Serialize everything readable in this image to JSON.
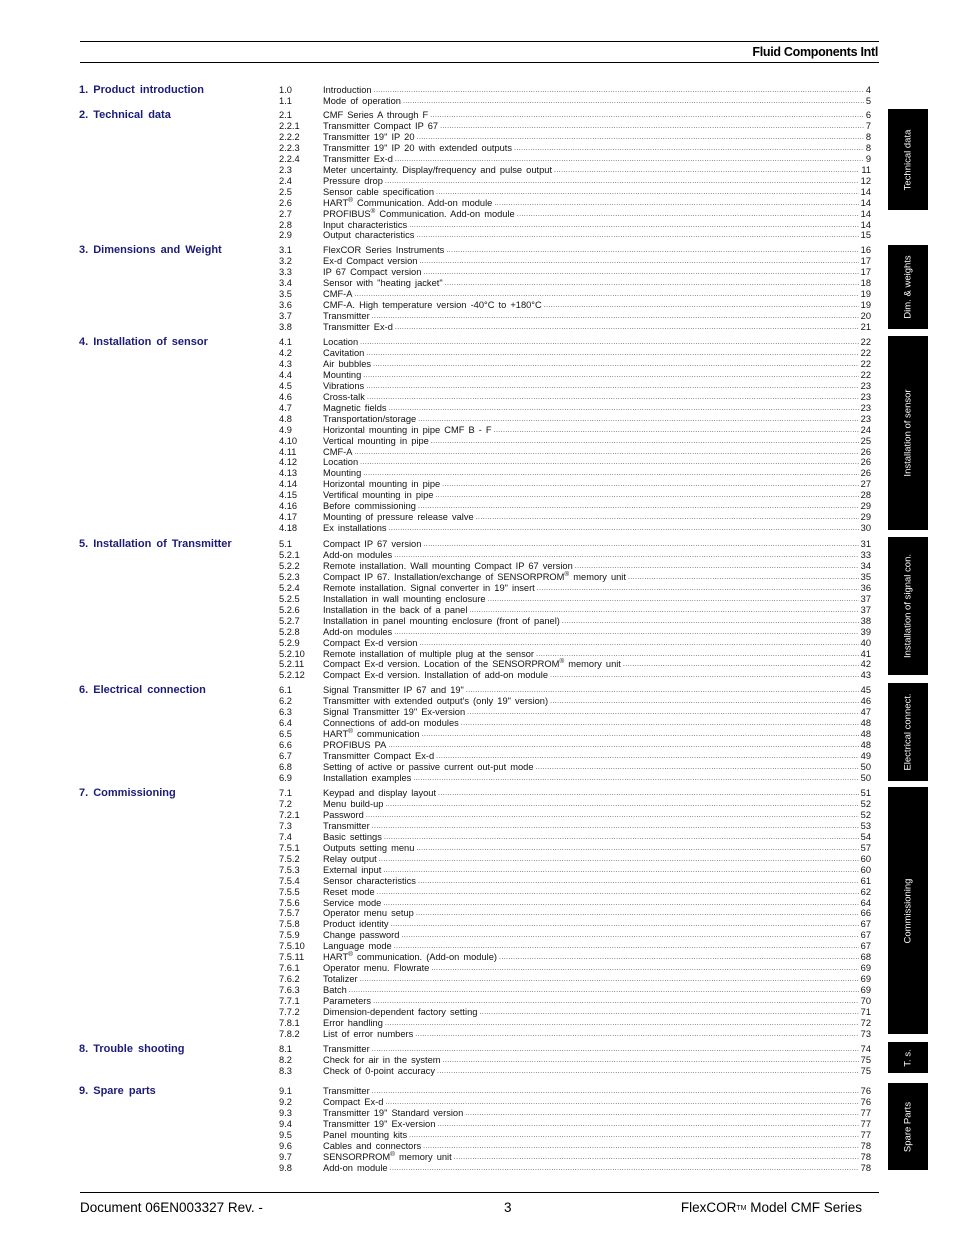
{
  "header": {
    "company": "Fluid Components Intl"
  },
  "sections": [
    {
      "title": "1.  Product introduction",
      "entries": [
        {
          "num": "1.0",
          "title": "Introduction",
          "page": "4"
        },
        {
          "num": "1.1",
          "title": "Mode of operation",
          "page": "5"
        }
      ]
    },
    {
      "title": "2.  Technical  data",
      "entries": [
        {
          "num": "2.1",
          "title": "CMF Series A through F",
          "page": "6"
        },
        {
          "num": "2.2.1",
          "title": "Transmitter Compact IP 67",
          "page": "7"
        },
        {
          "num": "2.2.2",
          "title": "Transmitter 19\" IP 20",
          "page": "8"
        },
        {
          "num": "2.2.3",
          "title": "Transmitter 19\" IP 20 with extended outputs",
          "page": "8"
        },
        {
          "num": "2.2.4",
          "title": "Transmitter Ex-d",
          "page": "9"
        },
        {
          "num": "2.3",
          "title": "Meter uncertainty. Display/frequency and pulse output",
          "page": "11"
        },
        {
          "num": "2.4",
          "title": "Pressure drop",
          "page": "12"
        },
        {
          "num": "2.5",
          "title": "Sensor cable specification",
          "page": "14"
        },
        {
          "num": "2.6",
          "title": "HART® Communication. Add-on module",
          "page": "14"
        },
        {
          "num": "2.7",
          "title": "PROFIBUS® Communication. Add-on module",
          "page": "14"
        },
        {
          "num": "2.8",
          "title": "Input characteristics",
          "page": "14"
        },
        {
          "num": "2.9",
          "title": "Output characteristics",
          "page": "15"
        }
      ]
    },
    {
      "title": "3.  Dimensions and  Weight",
      "entries": [
        {
          "num": "3.1",
          "title": "FlexCOR Series Instruments",
          "page": "16"
        },
        {
          "num": "3.2",
          "title": "Ex-d Compact version",
          "page": "17"
        },
        {
          "num": "3.3",
          "title": "IP 67 Compact version",
          "page": "17"
        },
        {
          "num": "3.4",
          "title": "Sensor with \"heating jacket\"",
          "page": "18"
        },
        {
          "num": "3.5",
          "title": "CMF-A",
          "page": "19"
        },
        {
          "num": "3.6",
          "title": "CMF-A. High temperature version -40°C to +180°C",
          "page": "19"
        },
        {
          "num": "3.7",
          "title": "Transmitter",
          "page": "20"
        },
        {
          "num": "3.8",
          "title": "Transmitter Ex-d",
          "page": "21"
        }
      ]
    },
    {
      "title": "4.  Installation of sensor",
      "entries": [
        {
          "num": "4.1",
          "title": "Location",
          "page": "22"
        },
        {
          "num": "4.2",
          "title": "Cavitation",
          "page": "22"
        },
        {
          "num": "4.3",
          "title": "Air bubbles",
          "page": "22"
        },
        {
          "num": "4.4",
          "title": "Mounting",
          "page": "22"
        },
        {
          "num": "4.5",
          "title": "Vibrations",
          "page": "23"
        },
        {
          "num": "4.6",
          "title": "Cross-talk",
          "page": "23"
        },
        {
          "num": "4.7",
          "title": "Magnetic fields",
          "page": "23"
        },
        {
          "num": "4.8",
          "title": "Transportation/storage",
          "page": "23"
        },
        {
          "num": "4.9",
          "title": "Horizontal mounting in pipe CMF B - F",
          "page": "24"
        },
        {
          "num": "4.10",
          "title": "Vertical mounting in pipe",
          "page": "25"
        },
        {
          "num": "4.11",
          "title": "CMF-A",
          "page": "26"
        },
        {
          "num": "4.12",
          "title": "Location",
          "page": "26"
        },
        {
          "num": "4.13",
          "title": "Mounting",
          "page": "26"
        },
        {
          "num": "4.14",
          "title": "Horizontal mounting in pipe",
          "page": "27"
        },
        {
          "num": "4.15",
          "title": "Vertifical mounting in pipe",
          "page": "28"
        },
        {
          "num": "4.16",
          "title": "Before commissioning",
          "page": "29"
        },
        {
          "num": "4.17",
          "title": "Mounting of pressure release valve",
          "page": "29"
        },
        {
          "num": "4.18",
          "title": "Ex installations",
          "page": "30"
        }
      ]
    },
    {
      "title": "5.  Installation of Transmitter",
      "entries": [
        {
          "num": "5.1",
          "title": "Compact IP 67 version",
          "page": "31"
        },
        {
          "num": "5.2.1",
          "title": "Add-on modules",
          "page": "33"
        },
        {
          "num": "5.2.2",
          "title": "Remote installation. Wall mounting Compact IP 67 version",
          "page": "34"
        },
        {
          "num": "5.2.3",
          "title": "Compact IP 67. Installation/exchange of SENSORPROM® memory unit",
          "page": "35"
        },
        {
          "num": "5.2.4",
          "title": "Remote installation. Signal converter in 19\" insert",
          "page": "36"
        },
        {
          "num": "5.2.5",
          "title": "Installation in wall mounting enclosure",
          "page": "37"
        },
        {
          "num": "5.2.6",
          "title": "Installation in the back of a panel",
          "page": "37"
        },
        {
          "num": "5.2.7",
          "title": "Installation in panel mounting enclosure (front of panel)",
          "page": "38"
        },
        {
          "num": "5.2.8",
          "title": "Add-on modules",
          "page": "39"
        },
        {
          "num": "5.2.9",
          "title": "Compact Ex-d version",
          "page": "40"
        },
        {
          "num": "5.2.10",
          "title": "Remote installation of multiple plug at the sensor",
          "page": "41"
        },
        {
          "num": "5.2.11",
          "title": "Compact Ex-d version. Location of the SENSORPROM® memory unit",
          "page": "42"
        },
        {
          "num": "5.2.12",
          "title": "Compact Ex-d version. Installation of add-on module",
          "page": "43"
        }
      ]
    },
    {
      "title": "6.  Electrical  connection",
      "entries": [
        {
          "num": "6.1",
          "title": "Signal Transmitter IP 67 and 19\"",
          "page": "45"
        },
        {
          "num": "6.2",
          "title": "Transmitter with extended output's (only 19\" version)",
          "page": "46"
        },
        {
          "num": "6.3",
          "title": "Signal Transmitter 19\" Ex-version",
          "page": "47"
        },
        {
          "num": "6.4",
          "title": "Connections of add-on modules",
          "page": "48"
        },
        {
          "num": "6.5",
          "title": "HART® communication",
          "page": "48"
        },
        {
          "num": "6.6",
          "title": "PROFIBUS PA",
          "page": "48"
        },
        {
          "num": "6.7",
          "title": "Transmitter Compact Ex-d",
          "page": "49"
        },
        {
          "num": "6.8",
          "title": "Setting of active or passive current out-put mode",
          "page": "50"
        },
        {
          "num": "6.9",
          "title": "Installation examples",
          "page": "50"
        }
      ]
    },
    {
      "title": "7.  Commissioning",
      "entries": [
        {
          "num": "7.1",
          "title": "Keypad and display layout",
          "page": "51"
        },
        {
          "num": "7.2",
          "title": "Menu build-up",
          "page": "52"
        },
        {
          "num": "7.2.1",
          "title": "Password",
          "page": "52"
        },
        {
          "num": "7.3",
          "title": "Transmitter",
          "page": "53"
        },
        {
          "num": "7.4",
          "title": "Basic settings",
          "page": "54"
        },
        {
          "num": "7.5.1",
          "title": "Outputs setting menu",
          "page": "57"
        },
        {
          "num": "7.5.2",
          "title": "Relay output",
          "page": "60"
        },
        {
          "num": "7.5.3",
          "title": "External input",
          "page": "60"
        },
        {
          "num": "7.5.4",
          "title": "Sensor characteristics",
          "page": "61"
        },
        {
          "num": "7.5.5",
          "title": "Reset mode",
          "page": "62"
        },
        {
          "num": "7.5.6",
          "title": "Service mode",
          "page": "64"
        },
        {
          "num": "7.5.7",
          "title": "Operator menu setup",
          "page": "66"
        },
        {
          "num": "7.5.8",
          "title": "Product identity",
          "page": "67"
        },
        {
          "num": "7.5.9",
          "title": "Change password",
          "page": "67"
        },
        {
          "num": "7.5.10",
          "title": "Language mode",
          "page": "67"
        },
        {
          "num": "7.5.11",
          "title": "HART® communication. (Add-on module)",
          "page": "68"
        },
        {
          "num": "7.6.1",
          "title": "Operator menu. Flowrate",
          "page": "69"
        },
        {
          "num": "7.6.2",
          "title": "Totalizer",
          "page": "69"
        },
        {
          "num": "7.6.3",
          "title": "Batch",
          "page": "69"
        },
        {
          "num": "7.7.1",
          "title": "Parameters",
          "page": "70"
        },
        {
          "num": "7.7.2",
          "title": "Dimension-dependent factory setting",
          "page": "71"
        },
        {
          "num": "7.8.1",
          "title": "Error handling",
          "page": "72"
        },
        {
          "num": "7.8.2",
          "title": "List of error numbers",
          "page": "73"
        }
      ]
    },
    {
      "title": "8.  Trouble shooting",
      "entries": [
        {
          "num": "8.1",
          "title": "Transmitter",
          "page": "74"
        },
        {
          "num": "8.2",
          "title": "Check for air in the system",
          "page": "75"
        },
        {
          "num": "8.3",
          "title": "Check of 0-point accuracy",
          "page": "75"
        }
      ]
    },
    {
      "title": "9.  Spare parts",
      "entries": [
        {
          "num": "9.1",
          "title": "Transmitter",
          "page": "76"
        },
        {
          "num": "9.2",
          "title": "Compact Ex-d",
          "page": "76"
        },
        {
          "num": "9.3",
          "title": "Transmitter 19\" Standard version",
          "page": "77"
        },
        {
          "num": "9.4",
          "title": "Transmitter 19\" Ex-version",
          "page": "77"
        },
        {
          "num": "9.5",
          "title": "Panel mounting kits",
          "page": "77"
        },
        {
          "num": "9.6",
          "title": "Cables and connectors",
          "page": "78"
        },
        {
          "num": "9.7",
          "title": "SENSORPROM® memory unit",
          "page": "78"
        },
        {
          "num": "9.8",
          "title": "Add-on module",
          "page": "78"
        }
      ]
    }
  ],
  "side_tabs": [
    {
      "label": "Technical data"
    },
    {
      "label": "Dim. & weights"
    },
    {
      "label": "Installation of sensor"
    },
    {
      "label": "Installation of signal con."
    },
    {
      "label": "Electrical connect."
    },
    {
      "label": "Commissioning"
    },
    {
      "label": "T. s."
    },
    {
      "label": "Spare Parts"
    }
  ],
  "footer": {
    "document": "Document 06EN003327 Rev. -",
    "page_number": "3",
    "model_prefix": "FlexCOR",
    "model_trademark": "TM",
    "model_suffix": " Model CMF Series"
  },
  "colors": {
    "section_heading": "#1c1c78",
    "tab_background": "#000000",
    "tab_text": "#ffffff"
  }
}
